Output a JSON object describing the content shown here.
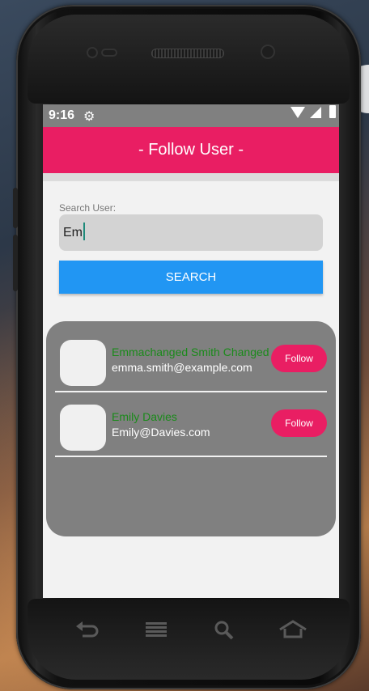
{
  "status_bar": {
    "time": "9:16",
    "icons": [
      "settings-icon",
      "wifi-icon",
      "signal-icon",
      "battery-icon"
    ]
  },
  "app_bar": {
    "title": "- Follow User -",
    "color": "#e91e63"
  },
  "search": {
    "label": "Search User:",
    "value": "Em",
    "button_label": "SEARCH",
    "button_color": "#2196f3"
  },
  "results": [
    {
      "name": "Emmachanged Smith Changed",
      "email": "emma.smith@example.com",
      "action": "Follow"
    },
    {
      "name": "Emily Davies",
      "email": "Emily@Davies.com",
      "action": "Follow"
    }
  ],
  "nav": {
    "icons": [
      "back-icon",
      "menu-icon",
      "search-icon",
      "home-icon"
    ]
  }
}
